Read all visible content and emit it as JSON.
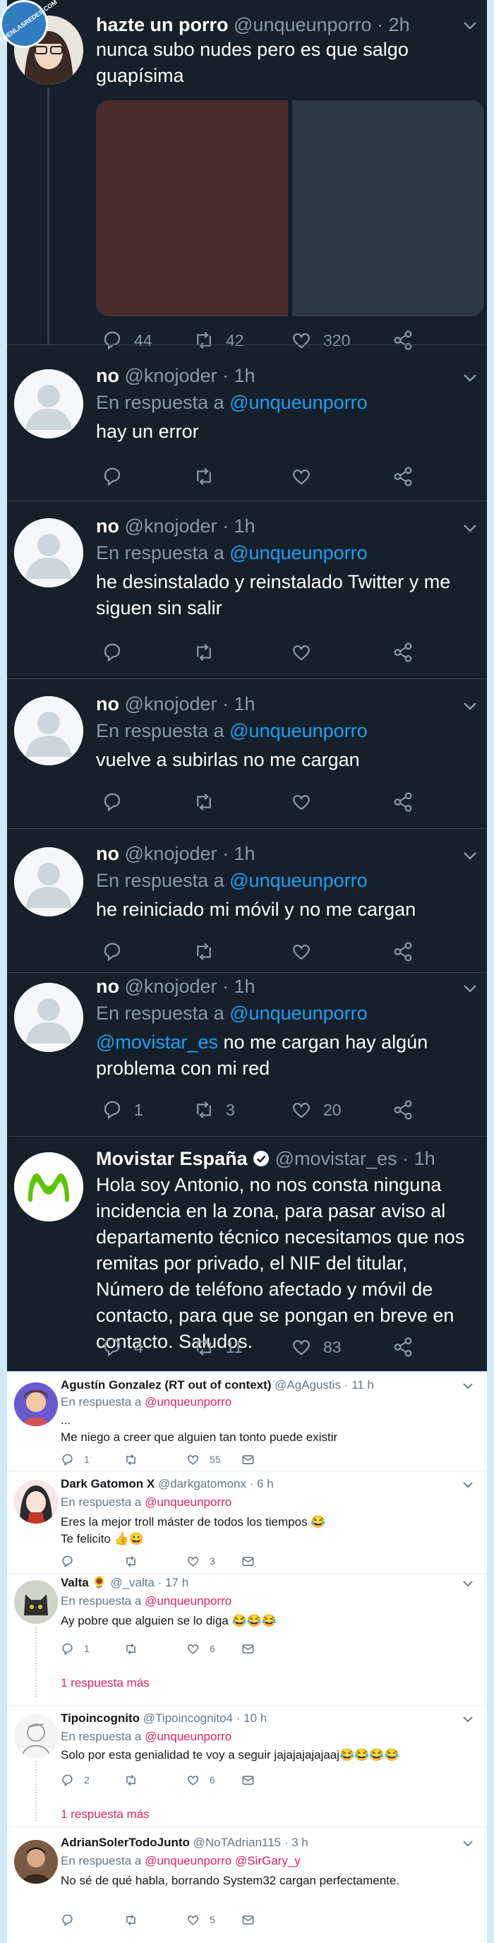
{
  "watermark": "VISTOENLASREDES.COM",
  "main_tweet": {
    "name": "hazte un porro",
    "handle": "@unqueunporro",
    "time": "· 2h",
    "text": "nunca subo nudes pero es que salgo guapísima",
    "replies": "44",
    "retweets": "42",
    "likes": "320"
  },
  "replies": [
    {
      "name": "no",
      "handle": "@knojoder",
      "time": "· 1h",
      "reply_prefix": "En respuesta a",
      "reply_to": "@unqueunporro",
      "text": "hay un error",
      "mention": "",
      "replies": "",
      "retweets": "",
      "likes": ""
    },
    {
      "name": "no",
      "handle": "@knojoder",
      "time": "· 1h",
      "reply_prefix": "En respuesta a",
      "reply_to": "@unqueunporro",
      "text": "he desinstalado y reinstalado Twitter y me siguen sin salir",
      "mention": "",
      "replies": "",
      "retweets": "",
      "likes": ""
    },
    {
      "name": "no",
      "handle": "@knojoder",
      "time": "· 1h",
      "reply_prefix": "En respuesta a",
      "reply_to": "@unqueunporro",
      "text": "vuelve a subirlas no me cargan",
      "mention": "",
      "replies": "",
      "retweets": "",
      "likes": ""
    },
    {
      "name": "no",
      "handle": "@knojoder",
      "time": "· 1h",
      "reply_prefix": "En respuesta a",
      "reply_to": "@unqueunporro",
      "text": "he reiniciado mi móvil y no me cargan",
      "mention": "",
      "replies": "",
      "retweets": "",
      "likes": ""
    },
    {
      "name": "no",
      "handle": "@knojoder",
      "time": "· 1h",
      "reply_prefix": "En respuesta a",
      "reply_to": "@unqueunporro",
      "text": " no me cargan hay algún problema con mi red",
      "mention": "@movistar_es",
      "replies": "1",
      "retweets": "3",
      "likes": "20"
    }
  ],
  "movistar": {
    "name": "Movistar España",
    "handle": "@movistar_es",
    "time": "· 1h",
    "text": "Hola soy Antonio, no nos consta ninguna incidencia en la zona, para pasar aviso al departamento técnico necesitamos que nos remitas por privado, el NIF del titular, Número de teléfono afectado y móvil de contacto, para que se pongan en breve en contacto. Saludos.",
    "replies": "4",
    "retweets": "11",
    "likes": "83"
  },
  "light_tweets": [
    {
      "name": "Agustín Gonzalez (RT out of context)",
      "handle": "@AgAgustis",
      "time": "· 11 h",
      "reply_prefix": "En respuesta a",
      "reply_to": "@unqueunporro",
      "text": "...\nMe niego a creer que alguien tan tonto puede existir",
      "replies": "1",
      "retweets": "",
      "likes": "55",
      "more": ""
    },
    {
      "name": "Dark Gatomon X",
      "handle": "@darkgatomonx",
      "time": "· 6 h",
      "reply_prefix": "En respuesta a",
      "reply_to": "@unqueunporro",
      "text": "Eres la mejor troll máster de todos los tiempos 😂\nTe felicito 👍😀",
      "replies": "",
      "retweets": "",
      "likes": "3",
      "more": ""
    },
    {
      "name": "Valta 🌻",
      "handle": "@_valta",
      "time": "· 17 h",
      "reply_prefix": "En respuesta a",
      "reply_to": "@unqueunporro",
      "text": "Ay pobre que alguien se lo diga 😂😂😂",
      "replies": "1",
      "retweets": "",
      "likes": "6",
      "more": "1 respuesta más"
    },
    {
      "name": "Tipoincognito",
      "handle": "@Tipoincognito4",
      "time": "· 10 h",
      "reply_prefix": "En respuesta a",
      "reply_to": "@unqueunporro",
      "text": "Solo por esta genialidad te voy a seguir jajajajajajaaj😂😂😂😂",
      "replies": "2",
      "retweets": "",
      "likes": "6",
      "more": "1 respuesta más"
    },
    {
      "name": "AdrianSolerTodoJunto",
      "handle": "@NoTAdrian115",
      "time": "· 3 h",
      "reply_prefix": "En respuesta a",
      "reply_to": "@unqueunporro @SirGary_y",
      "text": "No sé de qué habla, borrando System32 cargan perfectamente.",
      "replies": "",
      "retweets": "",
      "likes": "5",
      "more": ""
    }
  ],
  "colors": {
    "dark_bg": "#15202b",
    "link": "#1da1f2",
    "light_link": "#e0245e",
    "movistar_green": "#5bc500"
  },
  "icons": [
    "reply-icon",
    "retweet-icon",
    "like-icon",
    "share-icon",
    "mail-icon",
    "chevron-down-icon",
    "verified-icon"
  ]
}
